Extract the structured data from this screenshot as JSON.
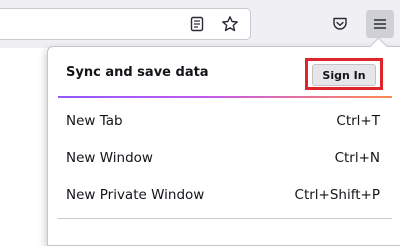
{
  "toolbar": {
    "icons": [
      "reader-view-icon",
      "bookmark-star-icon",
      "pocket-icon",
      "hamburger-menu-icon"
    ]
  },
  "menu": {
    "sync": {
      "title": "Sync and save data",
      "button_label": "Sign In"
    },
    "items": [
      {
        "label": "New Tab",
        "shortcut": "Ctrl+T"
      },
      {
        "label": "New Window",
        "shortcut": "Ctrl+N"
      },
      {
        "label": "New Private Window",
        "shortcut": "Ctrl+Shift+P"
      }
    ]
  },
  "colors": {
    "highlight": "#e0242c",
    "toolbar_bg": "#f0f0f4",
    "separator_gradient": [
      "#9059ff",
      "#c45aeb",
      "#ff8a50"
    ]
  }
}
